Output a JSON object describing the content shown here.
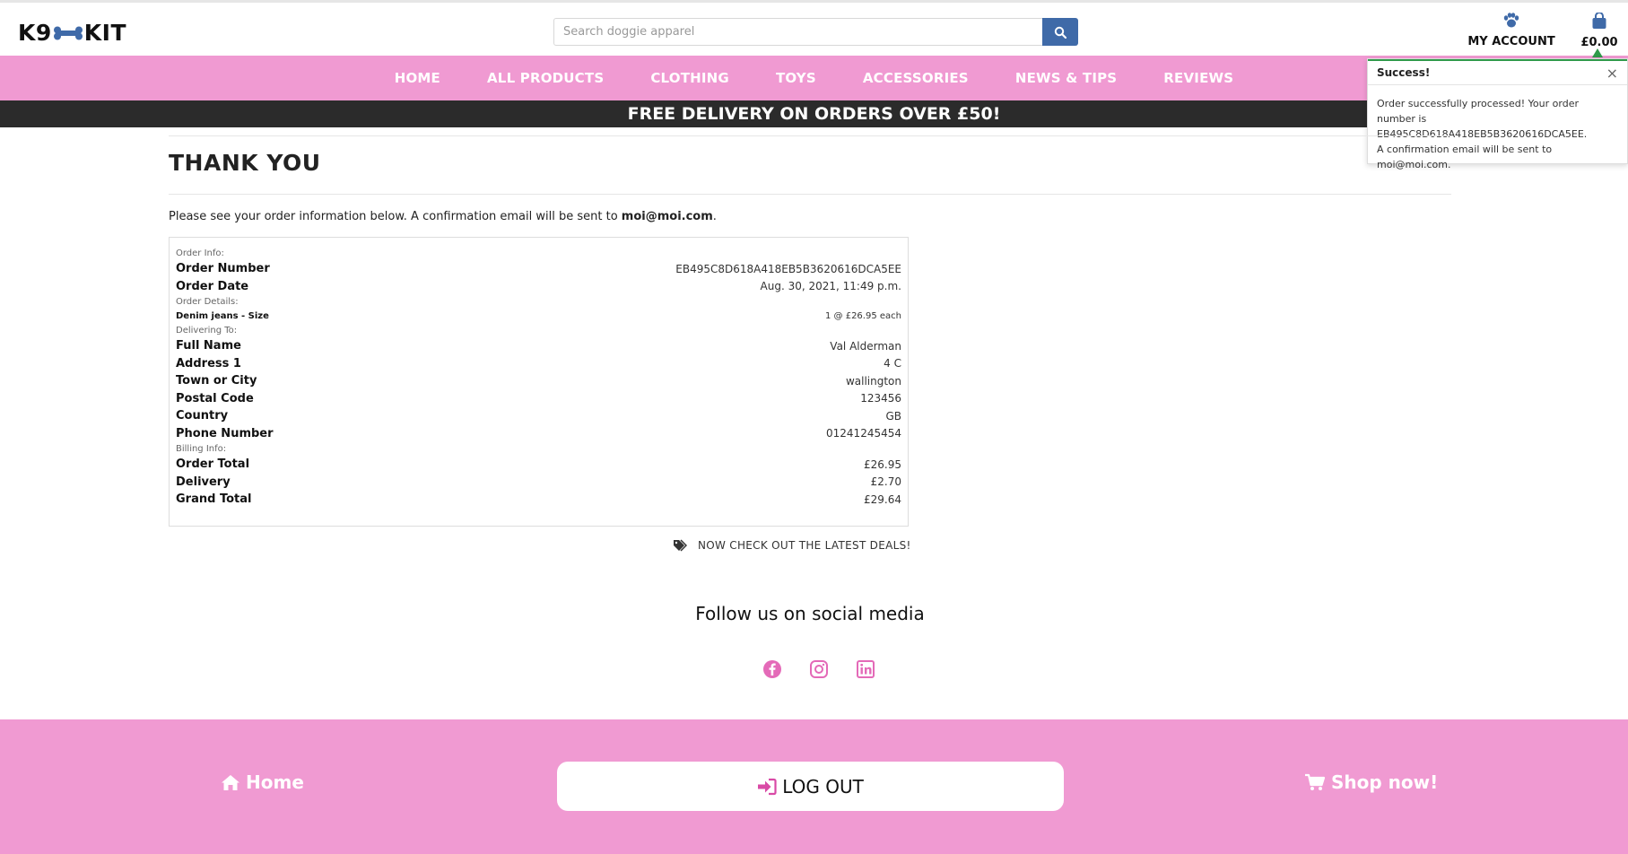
{
  "brand": {
    "logo_left": "K9",
    "logo_right": "KIT"
  },
  "search": {
    "placeholder": "Search doggie apparel"
  },
  "header": {
    "account_label": "MY ACCOUNT",
    "cart_total": "£0.00"
  },
  "nav": {
    "items": [
      {
        "label": "HOME"
      },
      {
        "label": "ALL PRODUCTS"
      },
      {
        "label": "CLOTHING"
      },
      {
        "label": "TOYS"
      },
      {
        "label": "ACCESSORIES"
      },
      {
        "label": "NEWS & TIPS"
      },
      {
        "label": "REVIEWS"
      }
    ]
  },
  "promo": {
    "text": "FREE DELIVERY ON ORDERS OVER £50!"
  },
  "toast": {
    "title": "Success!",
    "close": "×",
    "message": "Order successfully processed! Your order number is EB495C8D618A418EB5B3620616DCA5EE. A confirmation email will be sent to moi@moi.com."
  },
  "page": {
    "title": "THANK YOU",
    "intro_text": "Please see your order information below. A confirmation email will be sent to ",
    "email": "moi@moi.com",
    "intro_end": "."
  },
  "order": {
    "order_info_label": "Order Info:",
    "order_number_label": "Order Number",
    "order_number": "EB495C8D618A418EB5B3620616DCA5EE",
    "order_date_label": "Order Date",
    "order_date": "Aug. 30, 2021, 11:49 p.m.",
    "order_details_label": "Order Details:",
    "item_name": "Denim jeans - Size",
    "item_qty": "1 @ £26.95 each",
    "delivering_label": "Delivering To:",
    "full_name_label": "Full Name",
    "full_name": "Val Alderman",
    "address1_label": "Address 1",
    "address1": "4 C",
    "town_label": "Town or City",
    "town": "wallington",
    "postal_label": "Postal Code",
    "postal": "123456",
    "country_label": "Country",
    "country": "GB",
    "phone_label": "Phone Number",
    "phone": "01241245454",
    "billing_label": "Billing Info:",
    "order_total_label": "Order Total",
    "order_total": "£26.95",
    "delivery_label": "Delivery",
    "delivery": "£2.70",
    "grand_total_label": "Grand Total",
    "grand_total": "£29.64"
  },
  "deals": {
    "label": "NOW CHECK OUT THE LATEST DEALS!"
  },
  "social": {
    "heading": "Follow us on social media"
  },
  "footer": {
    "home": "Home",
    "logout": "LOG OUT",
    "shop": "Shop now!"
  },
  "colors": {
    "pink": "#f09ad2",
    "dark": "#2b2b2b",
    "blue": "#3f6aa8",
    "success": "#2f9a4a"
  }
}
